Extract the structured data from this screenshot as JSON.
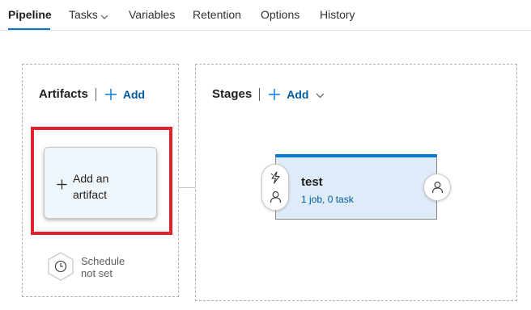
{
  "tabs": [
    {
      "label": "Pipeline",
      "active": true
    },
    {
      "label": "Tasks",
      "has_dropdown": true
    },
    {
      "label": "Variables"
    },
    {
      "label": "Retention"
    },
    {
      "label": "Options"
    },
    {
      "label": "History"
    }
  ],
  "artifacts": {
    "title": "Artifacts",
    "add_label": "Add",
    "card_line1": "Add an",
    "card_line2": "artifact",
    "schedule_line1": "Schedule",
    "schedule_line2": "not set"
  },
  "stages": {
    "title": "Stages",
    "add_label": "Add",
    "stage": {
      "name": "test",
      "summary": "1 job, 0 task"
    }
  },
  "colors": {
    "accent": "#0078d4",
    "link": "#005a9e",
    "highlight": "#e3202c",
    "stage_bg": "#deecf9",
    "card_bg": "#eff6fc"
  },
  "icons": [
    "chevron-down-icon",
    "plus-icon",
    "clock-icon",
    "lightning-icon",
    "person-icon"
  ]
}
